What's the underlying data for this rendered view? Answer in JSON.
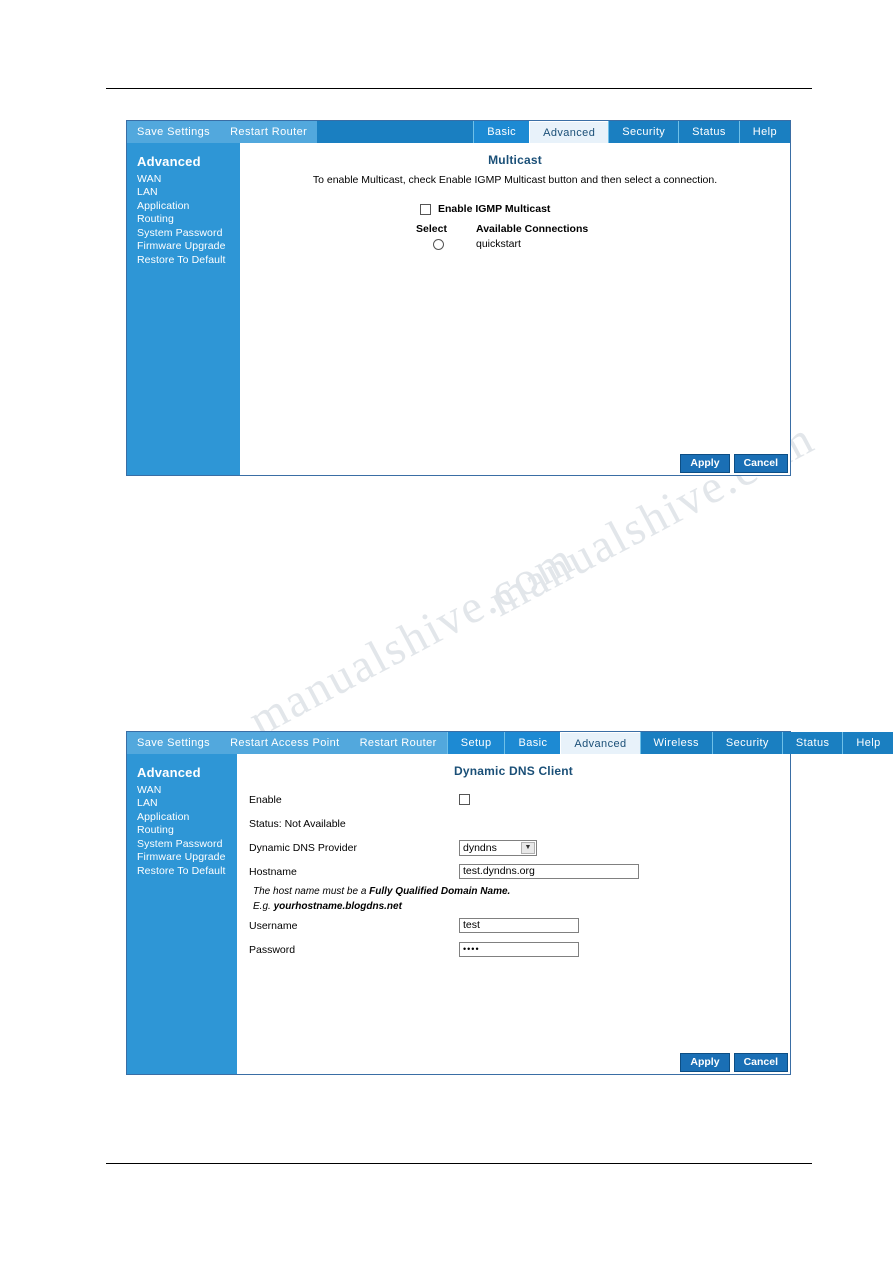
{
  "document": {
    "watermark_line1": "manualshive.com",
    "watermark_line2": "manualshive.com"
  },
  "multicast_panel": {
    "nav_left": [
      {
        "label": "Save Settings"
      },
      {
        "label": "Restart Router"
      }
    ],
    "nav_tabs": [
      {
        "label": "Basic",
        "state": "highlight"
      },
      {
        "label": "Advanced",
        "state": "active"
      },
      {
        "label": "Security",
        "state": "normal"
      },
      {
        "label": "Status",
        "state": "normal"
      },
      {
        "label": "Help",
        "state": "normal"
      }
    ],
    "sidebar": {
      "title": "Advanced",
      "items": [
        {
          "label": "WAN"
        },
        {
          "label": "LAN"
        },
        {
          "label": "Application"
        },
        {
          "label": "Routing"
        },
        {
          "label": "System Password"
        },
        {
          "label": "Firmware Upgrade"
        },
        {
          "label": "Restore To Default"
        }
      ]
    },
    "title": "Multicast",
    "description": "To enable Multicast, check Enable IGMP Multicast button and then select a connection.",
    "enable_label": "Enable IGMP Multicast",
    "table": {
      "col_select": "Select",
      "col_connections": "Available Connections",
      "rows": [
        {
          "connection": "quickstart"
        }
      ]
    },
    "buttons": {
      "apply": "Apply",
      "cancel": "Cancel"
    }
  },
  "ddns_panel": {
    "nav_left": [
      {
        "label": "Save Settings"
      },
      {
        "label": "Restart Access Point"
      },
      {
        "label": "Restart Router"
      }
    ],
    "nav_tabs": [
      {
        "label": "Setup",
        "state": "highlight"
      },
      {
        "label": "Basic",
        "state": "highlight"
      },
      {
        "label": "Advanced",
        "state": "active"
      },
      {
        "label": "Wireless",
        "state": "normal"
      },
      {
        "label": "Security",
        "state": "normal"
      },
      {
        "label": "Status",
        "state": "normal"
      },
      {
        "label": "Help",
        "state": "normal"
      }
    ],
    "sidebar": {
      "title": "Advanced",
      "items": [
        {
          "label": "WAN"
        },
        {
          "label": "LAN"
        },
        {
          "label": "Application"
        },
        {
          "label": "Routing"
        },
        {
          "label": "System Password"
        },
        {
          "label": "Firmware Upgrade"
        },
        {
          "label": "Restore To Default"
        }
      ]
    },
    "title": "Dynamic DNS Client",
    "fields": {
      "enable_label": "Enable",
      "status_label": "Status: Not Available",
      "provider_label": "Dynamic DNS Provider",
      "provider_value": "dyndns",
      "hostname_label": "Hostname",
      "hostname_value": "test.dyndns.org",
      "hint_prefix": "The host name must be a ",
      "hint_bold": "Fully Qualified Domain Name.",
      "hint_example_prefix": "E.g. ",
      "hint_example_bold": "yourhostname.blogdns.net",
      "username_label": "Username",
      "username_value": "test",
      "password_label": "Password",
      "password_value": "••••"
    },
    "buttons": {
      "apply": "Apply",
      "cancel": "Cancel"
    }
  },
  "colors": {
    "nav_blue": "#1a7fc1",
    "nav_left_blue": "#52a8dd",
    "sidebar_blue": "#2e96d6",
    "active_tab": "#e8f2fa",
    "title_text": "#1a4f77",
    "button_blue": "#1a6fb5"
  }
}
